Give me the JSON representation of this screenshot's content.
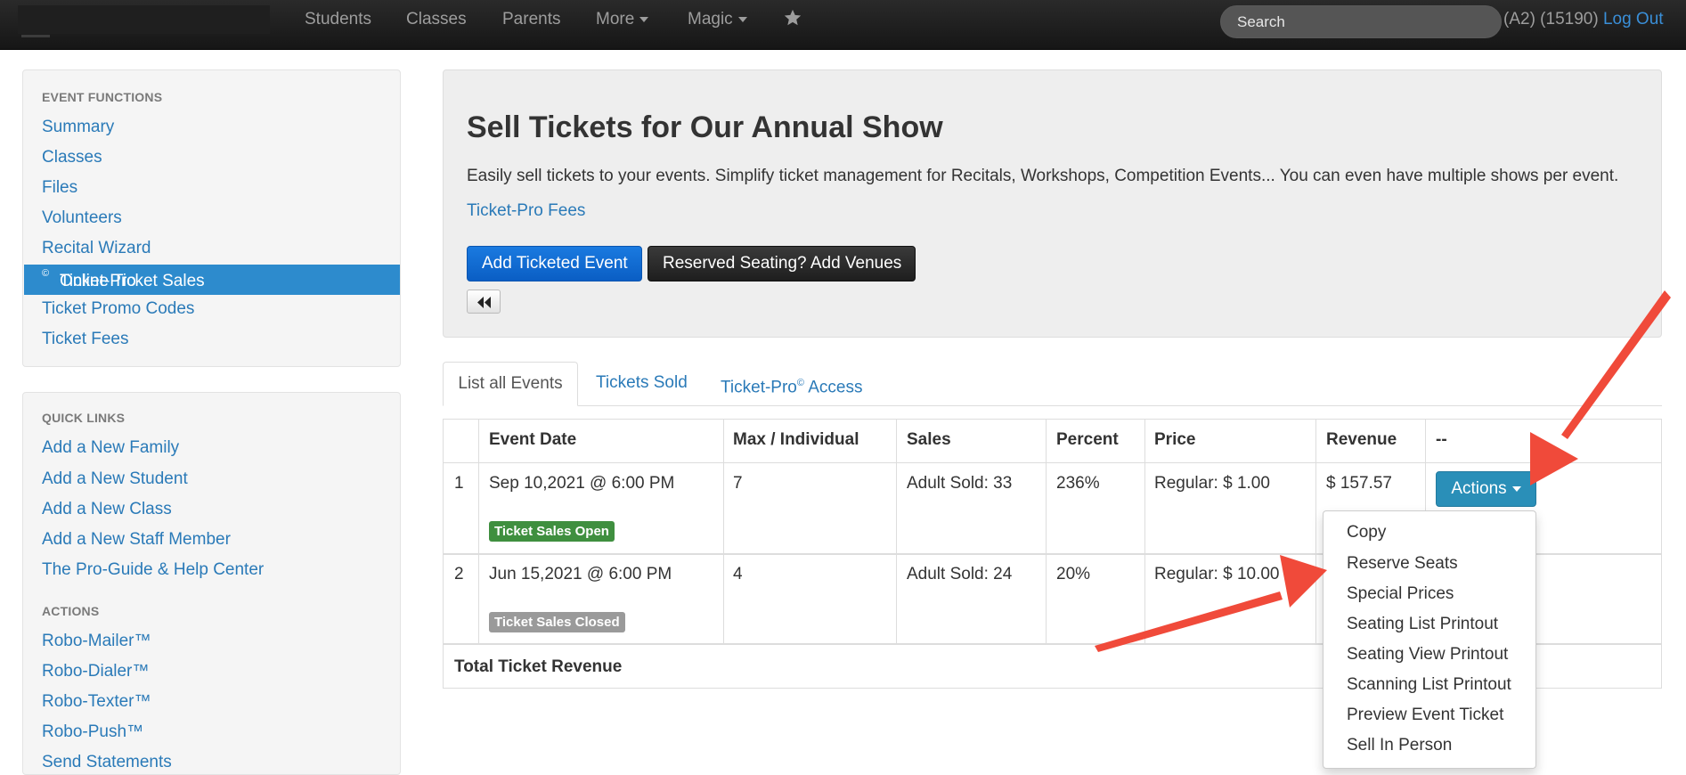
{
  "navbar": {
    "items": [
      {
        "label": "Students"
      },
      {
        "label": "Classes"
      },
      {
        "label": "Parents"
      },
      {
        "label": "More"
      },
      {
        "label": "Magic"
      }
    ],
    "star_icon": "star-icon",
    "search": {
      "placeholder": "Search",
      "value": ""
    },
    "user_info": "(A2) (15190)",
    "logout_label": "Log Out"
  },
  "sidebar": {
    "event_functions_header": "EVENT FUNCTIONS",
    "event_functions": [
      {
        "label": "Summary"
      },
      {
        "label": "Classes"
      },
      {
        "label": "Files"
      },
      {
        "label": "Volunteers"
      },
      {
        "label": "Recital Wizard"
      },
      {
        "label": "Ticket-Pro",
        "sup": "©",
        "suffix": " Online Ticket Sales",
        "active": true
      },
      {
        "label": "Ticket Promo Codes"
      },
      {
        "label": "Ticket Fees"
      }
    ],
    "quick_links_header": "QUICK LINKS",
    "quick_links": [
      {
        "label": "Add a New Family"
      },
      {
        "label": "Add a New Student"
      },
      {
        "label": "Add a New Class"
      },
      {
        "label": "Add a New Staff Member"
      },
      {
        "label": "The Pro-Guide & Help Center"
      }
    ],
    "actions_header": "ACTIONS",
    "actions": [
      {
        "label": "Robo-Mailer™"
      },
      {
        "label": "Robo-Dialer™"
      },
      {
        "label": "Robo-Texter™"
      },
      {
        "label": "Robo-Push™"
      },
      {
        "label": "Send Statements"
      }
    ]
  },
  "main": {
    "title": "Sell Tickets for Our Annual Show",
    "description": "Easily sell tickets to your events. Simplify ticket management for Recitals, Workshops, Competition Events... You can even have multiple shows per event.",
    "fees_link": "Ticket-Pro Fees",
    "add_event_button": "Add Ticketed Event",
    "add_venues_button": "Reserved Seating? Add Venues",
    "back_icon": "rewind-icon",
    "tabs": [
      {
        "label": "List all Events",
        "active": true
      },
      {
        "label": "Tickets Sold"
      },
      {
        "label": "Ticket-Pro",
        "sup": "©",
        "suffix": " Access"
      }
    ]
  },
  "table": {
    "headers": [
      "",
      "Event Date",
      "Max / Individual",
      "Sales",
      "Percent",
      "Price",
      "Revenue",
      "--"
    ],
    "rows": [
      {
        "num": "1",
        "date": "Sep 10,2021 @ 6:00 PM",
        "status": "Ticket Sales Open",
        "max": "7",
        "sales": "Adult Sold: 33",
        "percent": "236%",
        "price": "Regular: $ 1.00",
        "revenue": "$ 157.57",
        "actions_label": "Actions"
      },
      {
        "num": "2",
        "date": "Jun 15,2021 @ 6:00 PM",
        "status": "Ticket Sales Closed",
        "max": "4",
        "sales": "Adult Sold: 24",
        "percent": "20%",
        "price": "Regular: $ 10.00",
        "revenue": "",
        "actions_label": ""
      }
    ],
    "total_label": "Total Ticket Revenue"
  },
  "dropdown": {
    "items": [
      {
        "label": "Copy"
      },
      {
        "label": "Reserve Seats"
      },
      {
        "label": "Special Prices"
      },
      {
        "label": "Seating List Printout"
      },
      {
        "label": "Seating View Printout"
      },
      {
        "label": "Scanning List Printout"
      },
      {
        "label": "Preview Event Ticket"
      },
      {
        "label": "Sell In Person"
      }
    ]
  },
  "colors": {
    "navbar": "#1b1b1b",
    "link": "#2a7ab8",
    "active_sidebar": "#2d8bcd",
    "primary_button": "#0d6bd4",
    "actions_button": "#2a8fb8",
    "label_open": "#3f8f3f",
    "label_closed": "#9a9a9a",
    "annotation_arrow": "#f04a3a"
  }
}
